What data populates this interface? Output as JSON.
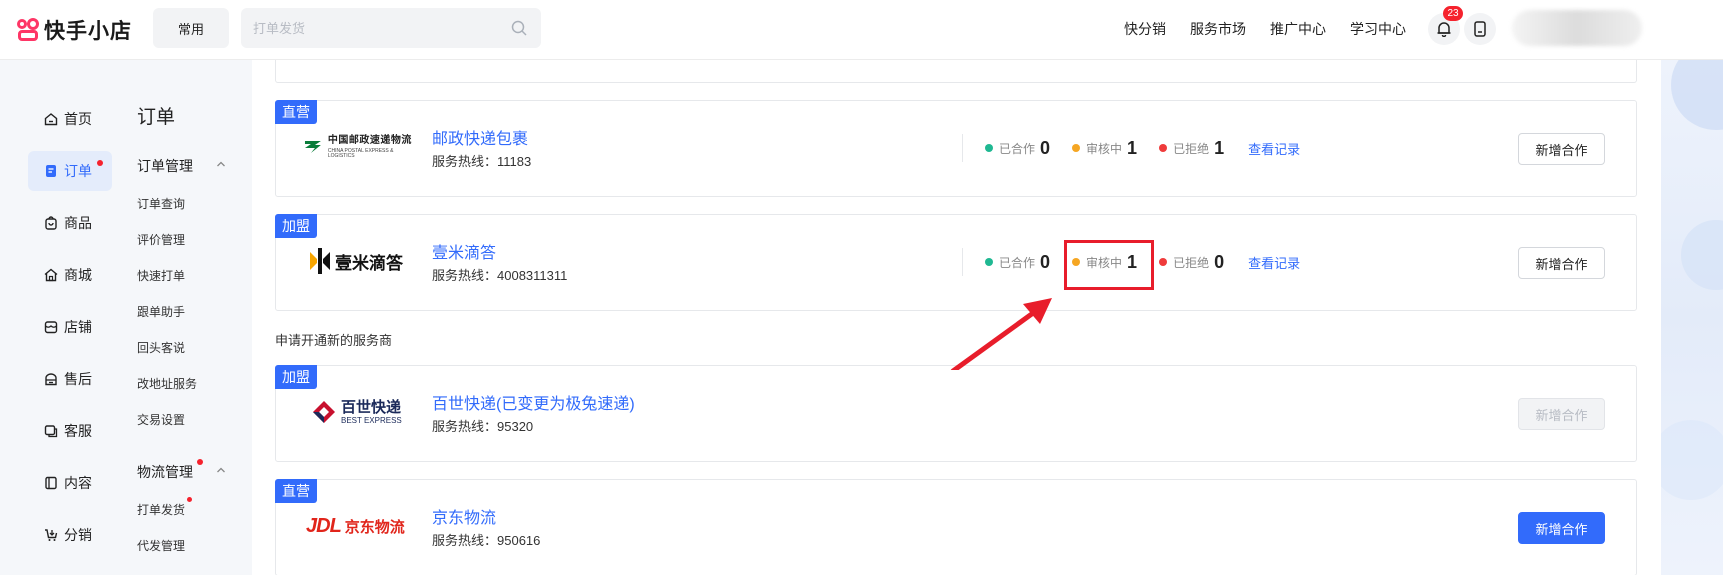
{
  "header": {
    "logo_text": "快手小店",
    "common_button": "常用",
    "search_placeholder": "打单发货",
    "links": [
      "快分销",
      "服务市场",
      "推广中心",
      "学习中心"
    ],
    "notification_count": "23"
  },
  "leftnav": {
    "items": [
      {
        "label": "首页",
        "icon": "home-icon"
      },
      {
        "label": "订单",
        "icon": "order-icon",
        "active": true,
        "dot": true
      },
      {
        "label": "商品",
        "icon": "product-icon"
      },
      {
        "label": "商城",
        "icon": "mall-icon"
      },
      {
        "label": "店铺",
        "icon": "store-icon"
      },
      {
        "label": "售后",
        "icon": "aftersale-icon"
      },
      {
        "label": "客服",
        "icon": "service-icon"
      },
      {
        "label": "内容",
        "icon": "content-icon"
      },
      {
        "label": "分销",
        "icon": "distribution-icon"
      }
    ]
  },
  "subnav": {
    "title": "订单",
    "group1": "订单管理",
    "group1_items": [
      "订单查询",
      "评价管理",
      "快速打单",
      "跟单助手",
      "回头客说",
      "改地址服务",
      "交易设置"
    ],
    "group2": "物流管理",
    "group2_items": [
      "打单发货",
      "代发管理"
    ]
  },
  "cards": [
    {
      "tag": "直营",
      "logo": "china-post",
      "logo_text_cn": "中国邮政速递物流",
      "logo_text_en": "CHINA POSTAL EXPRESS & LOGISTICS",
      "name": "邮政快递包裹",
      "hotline": "服务热线：11183",
      "stats": {
        "cooperating_label": "已合作",
        "cooperating": "0",
        "reviewing_label": "审核中",
        "reviewing": "1",
        "rejected_label": "已拒绝",
        "rejected": "1"
      },
      "record": "查看记录",
      "button": "新增合作"
    },
    {
      "tag": "加盟",
      "logo": "yimi",
      "logo_text_cn": "壹米滴答",
      "name": "壹米滴答",
      "hotline": "服务热线：4008311311",
      "stats": {
        "cooperating_label": "已合作",
        "cooperating": "0",
        "reviewing_label": "审核中",
        "reviewing": "1",
        "rejected_label": "已拒绝",
        "rejected": "0"
      },
      "record": "查看记录",
      "button": "新增合作"
    }
  ],
  "section_label": "申请开通新的服务商",
  "new_cards": [
    {
      "tag": "加盟",
      "logo": "best-express",
      "logo_text_cn": "百世快递",
      "logo_text_en": "BEST EXPRESS",
      "name": "百世快递(已变更为极兔速递)",
      "hotline": "服务热线：95320",
      "button": "新增合作"
    },
    {
      "tag": "直营",
      "logo": "jd-logistics",
      "logo_text_cn": "京东物流",
      "logo_text_en": "JDL",
      "name": "京东物流",
      "hotline": "服务热线：950616",
      "button": "新增合作"
    }
  ],
  "colors": {
    "accent": "#326bfb",
    "green": "#1fb892",
    "orange": "#f5a623",
    "red": "#ef3b3b",
    "highlight": "#e81d2b"
  }
}
